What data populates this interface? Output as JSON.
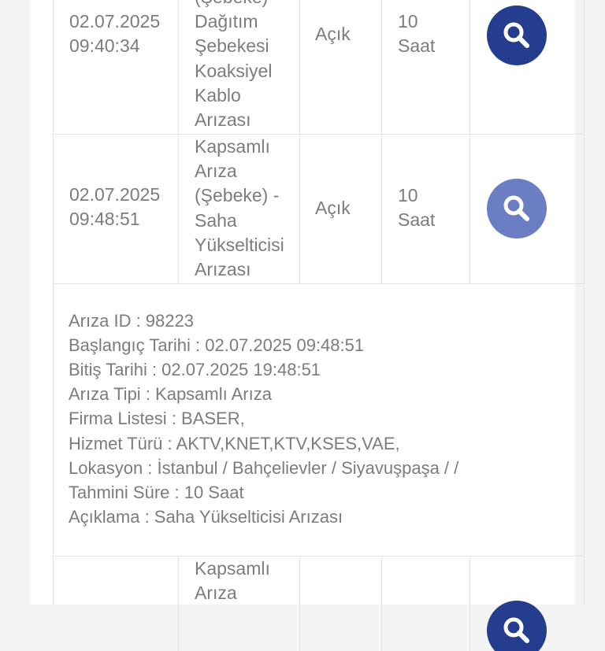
{
  "rows": [
    {
      "date": "02.07.2025",
      "time": "09:40:34",
      "type_lines": [
        "(Şebeke) -",
        "Dağıtım",
        "Şebekesi",
        "Koaksiyel",
        "Kablo",
        "Arızası"
      ],
      "status": "Açık",
      "duration_value": "10",
      "duration_unit": "Saat",
      "button_color": "#253d8e",
      "button_icon": "search-icon"
    },
    {
      "date": "02.07.2025",
      "time": "09:48:51",
      "type_lines": [
        "Kapsamlı",
        "Arıza",
        "(Şebeke) -",
        "Saha",
        "Yükselticisi",
        "Arızası"
      ],
      "status": "Açık",
      "duration_value": "10",
      "duration_unit": "Saat",
      "button_color": "#6b7ec4",
      "button_icon": "search-icon"
    },
    {
      "type_lines": [
        "Kapsamlı",
        "Arıza"
      ],
      "button_color": "#253d8e",
      "button_icon": "search-icon"
    }
  ],
  "detail": {
    "lines": [
      "Arıza ID : 98223",
      "Başlangıç Tarihi : 02.07.2025 09:48:51",
      "Bitiş Tarihi : 02.07.2025 19:48:51",
      "Arıza Tipi : Kapsamlı Arıza",
      "Firma Listesi : BASER,",
      "Hizmet Türü : AKTV,KNET,KTV,KSES,VAE,",
      "Lokasyon : İstanbul / Bahçelievler / Siyavuşpaşa / /",
      "Tahmini Süre : 10 Saat",
      "Açıklama : Saha Yükselticisi Arızası"
    ]
  }
}
